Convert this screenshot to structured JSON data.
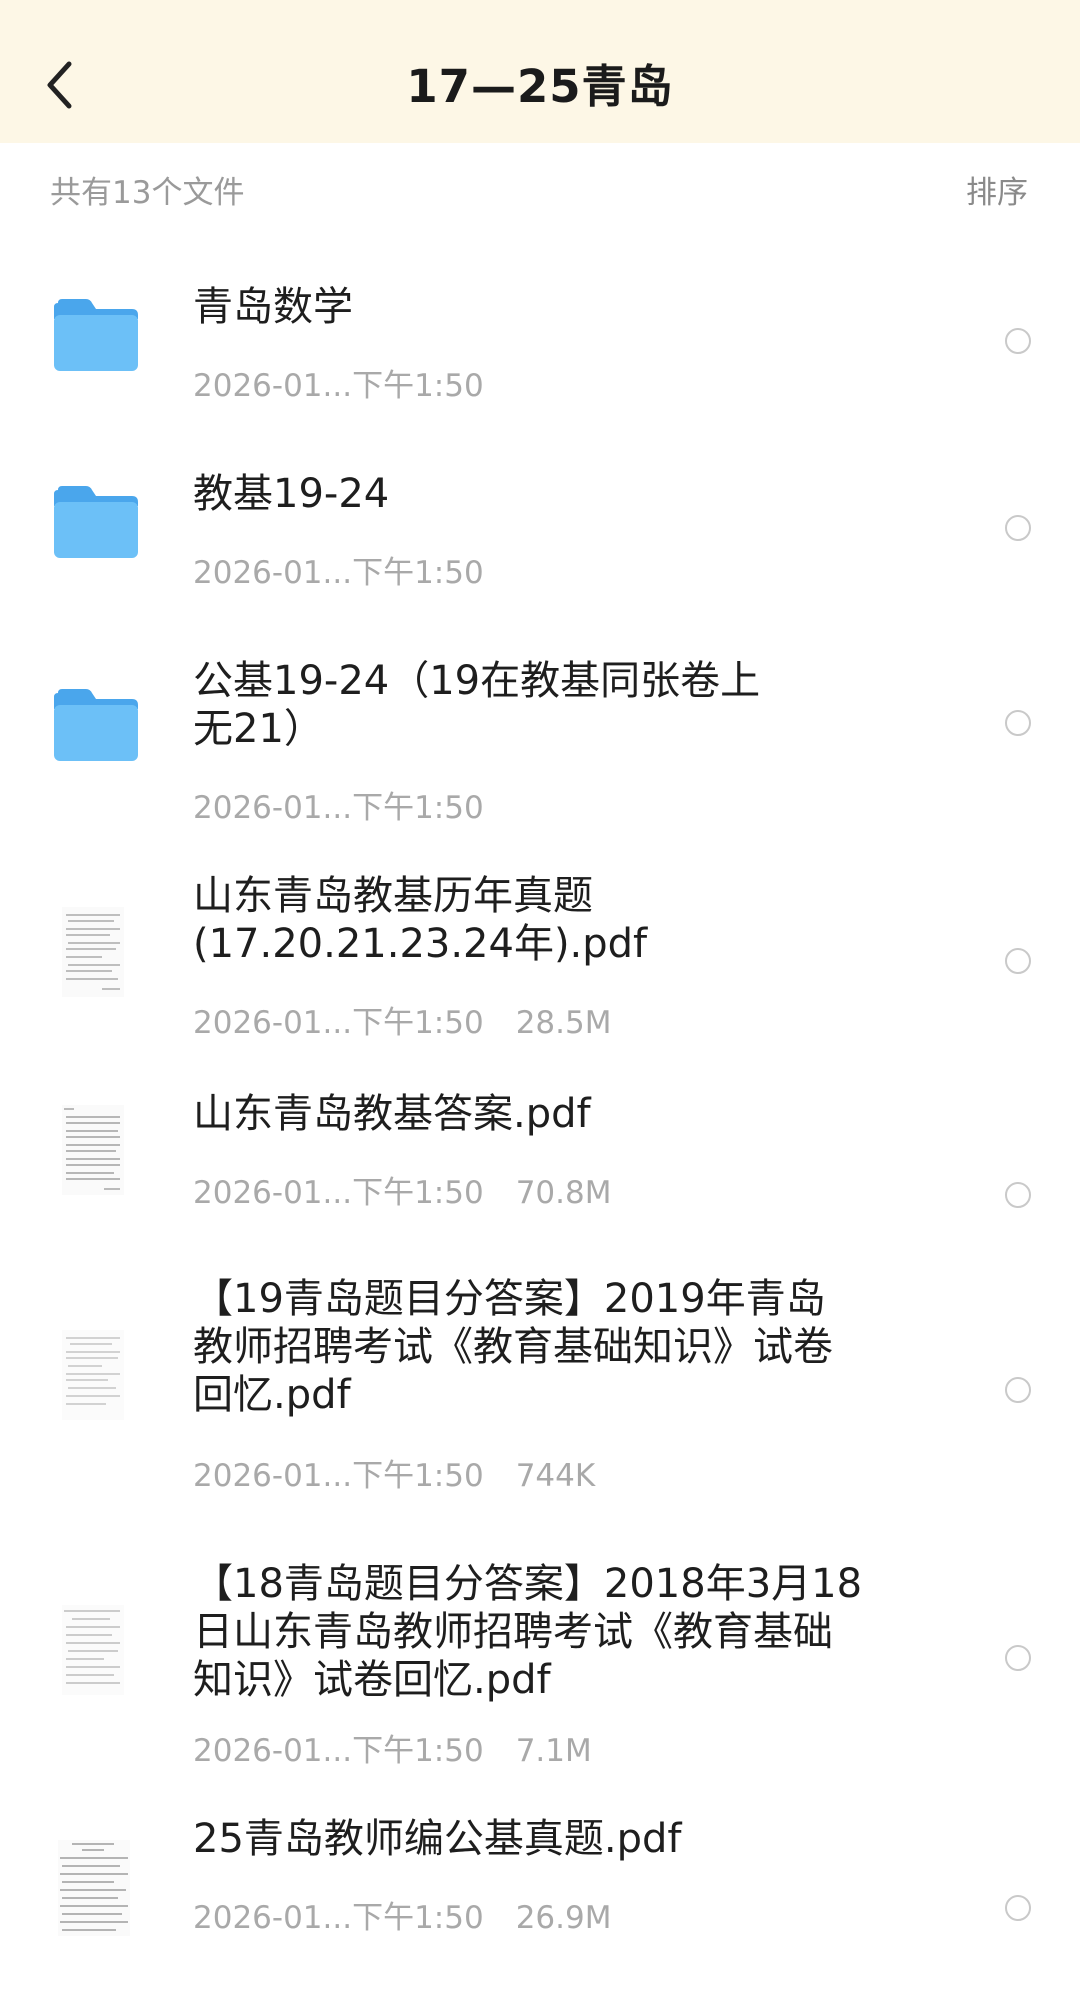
{
  "header": {
    "title": "17—25青岛",
    "back_icon": "chevron-left-icon"
  },
  "toolbar": {
    "count": "共有13个文件",
    "sort_label": "排序"
  },
  "colors": {
    "header_bg": "#fdf7e6",
    "folder_blue": "#5ab4f3"
  },
  "files": [
    {
      "type": "folder",
      "name": "青岛数学",
      "date": "2026-01...下午1:50",
      "size": ""
    },
    {
      "type": "folder",
      "name": "教基19-24",
      "date": "2026-01...下午1:50",
      "size": ""
    },
    {
      "type": "folder",
      "name": "公基19-24（19在教基同张卷上无21）",
      "date": "2026-01...下午1:50",
      "size": ""
    },
    {
      "type": "pdf",
      "name": "山东青岛教基历年真题(17.20.21.23.24年).pdf",
      "date": "2026-01...下午1:50",
      "size": "28.5M"
    },
    {
      "type": "pdf",
      "name": "山东青岛教基答案.pdf",
      "date": "2026-01...下午1:50",
      "size": "70.8M"
    },
    {
      "type": "pdf",
      "name": "【19青岛题目分答案】2019年青岛教师招聘考试《教育基础知识》试卷回忆.pdf",
      "date": "2026-01...下午1:50",
      "size": "744K"
    },
    {
      "type": "pdf",
      "name": "【18青岛题目分答案】2018年3月18日山东青岛教师招聘考试《教育基础知识》试卷回忆.pdf",
      "date": "2026-01...下午1:50",
      "size": "7.1M"
    },
    {
      "type": "pdf",
      "name": "25青岛教师编公基真题.pdf",
      "date": "2026-01...下午1:50",
      "size": "26.9M"
    }
  ]
}
